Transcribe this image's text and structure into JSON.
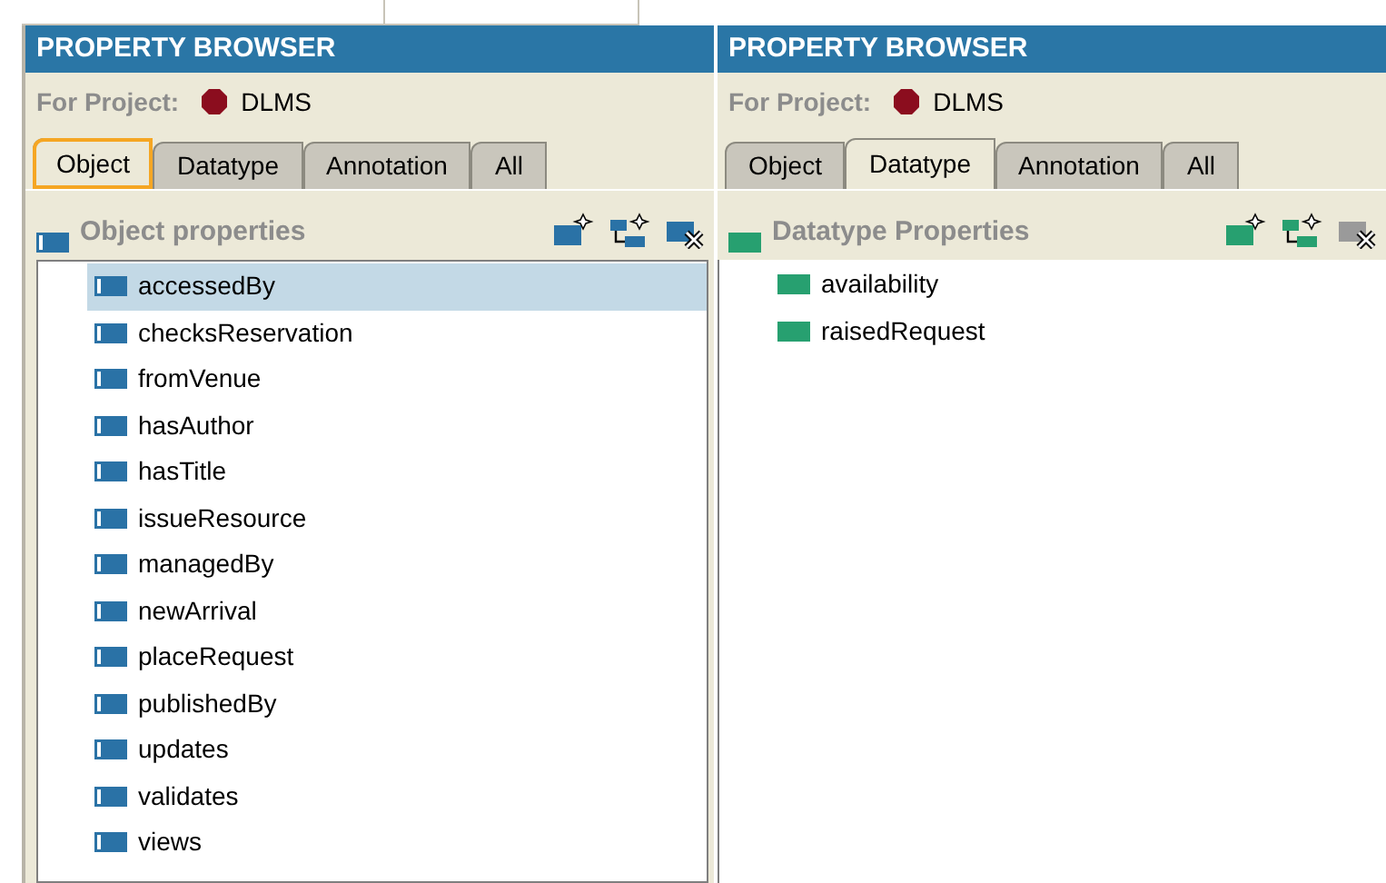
{
  "panels": [
    {
      "title": "PROPERTY BROWSER",
      "project_label": "For Project:",
      "project_name": "DLMS",
      "focused": true,
      "tabs": [
        {
          "label": "Object",
          "selected": true
        },
        {
          "label": "Datatype",
          "selected": false
        },
        {
          "label": "Annotation",
          "selected": false
        },
        {
          "label": "All",
          "selected": false
        }
      ],
      "section": {
        "kind": "object",
        "title": "Object properties"
      },
      "toolbar": [
        {
          "kind": "create",
          "disabled": false
        },
        {
          "kind": "create-sub",
          "disabled": false
        },
        {
          "kind": "delete",
          "disabled": false
        }
      ],
      "items": [
        {
          "label": "accessedBy",
          "selected": true
        },
        {
          "label": "checksReservation",
          "selected": false
        },
        {
          "label": "fromVenue",
          "selected": false
        },
        {
          "label": "hasAuthor",
          "selected": false
        },
        {
          "label": "hasTitle",
          "selected": false
        },
        {
          "label": "issueResource",
          "selected": false
        },
        {
          "label": "managedBy",
          "selected": false
        },
        {
          "label": "newArrival",
          "selected": false
        },
        {
          "label": "placeRequest",
          "selected": false
        },
        {
          "label": "publishedBy",
          "selected": false
        },
        {
          "label": "updates",
          "selected": false
        },
        {
          "label": "validates",
          "selected": false
        },
        {
          "label": "views",
          "selected": false
        }
      ]
    },
    {
      "title": "PROPERTY BROWSER",
      "project_label": "For Project:",
      "project_name": "DLMS",
      "focused": false,
      "tabs": [
        {
          "label": "Object",
          "selected": false
        },
        {
          "label": "Datatype",
          "selected": true
        },
        {
          "label": "Annotation",
          "selected": false
        },
        {
          "label": "All",
          "selected": false
        }
      ],
      "section": {
        "kind": "datatype",
        "title": "Datatype Properties"
      },
      "toolbar": [
        {
          "kind": "create",
          "disabled": false
        },
        {
          "kind": "create-sub",
          "disabled": false
        },
        {
          "kind": "delete",
          "disabled": true
        }
      ],
      "items": [
        {
          "label": "availability",
          "selected": false
        },
        {
          "label": "raisedRequest",
          "selected": false
        }
      ]
    }
  ]
}
